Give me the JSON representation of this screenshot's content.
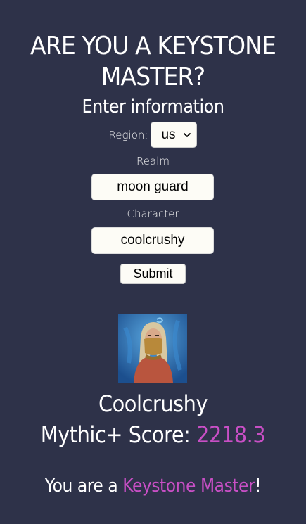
{
  "header": {
    "title_line1": "ARE YOU A KEYSTONE",
    "title_line2": "MASTER?",
    "subtitle": "Enter information"
  },
  "form": {
    "region_label": "Region:",
    "region_value": "us",
    "realm_label": "Realm",
    "realm_value": "moon guard",
    "character_label": "Character",
    "character_value": "coolcrushy",
    "submit_label": "Submit"
  },
  "result": {
    "character_name": "Coolcrushy",
    "score_label": "Mythic+ Score:",
    "score_value": "2218.3",
    "verdict_prefix": "You are a",
    "verdict_highlight": "Keystone Master",
    "verdict_suffix": "!"
  },
  "colors": {
    "background": "#2e3249",
    "accent": "#c84fc5",
    "input_bg": "#fdfcf6"
  }
}
